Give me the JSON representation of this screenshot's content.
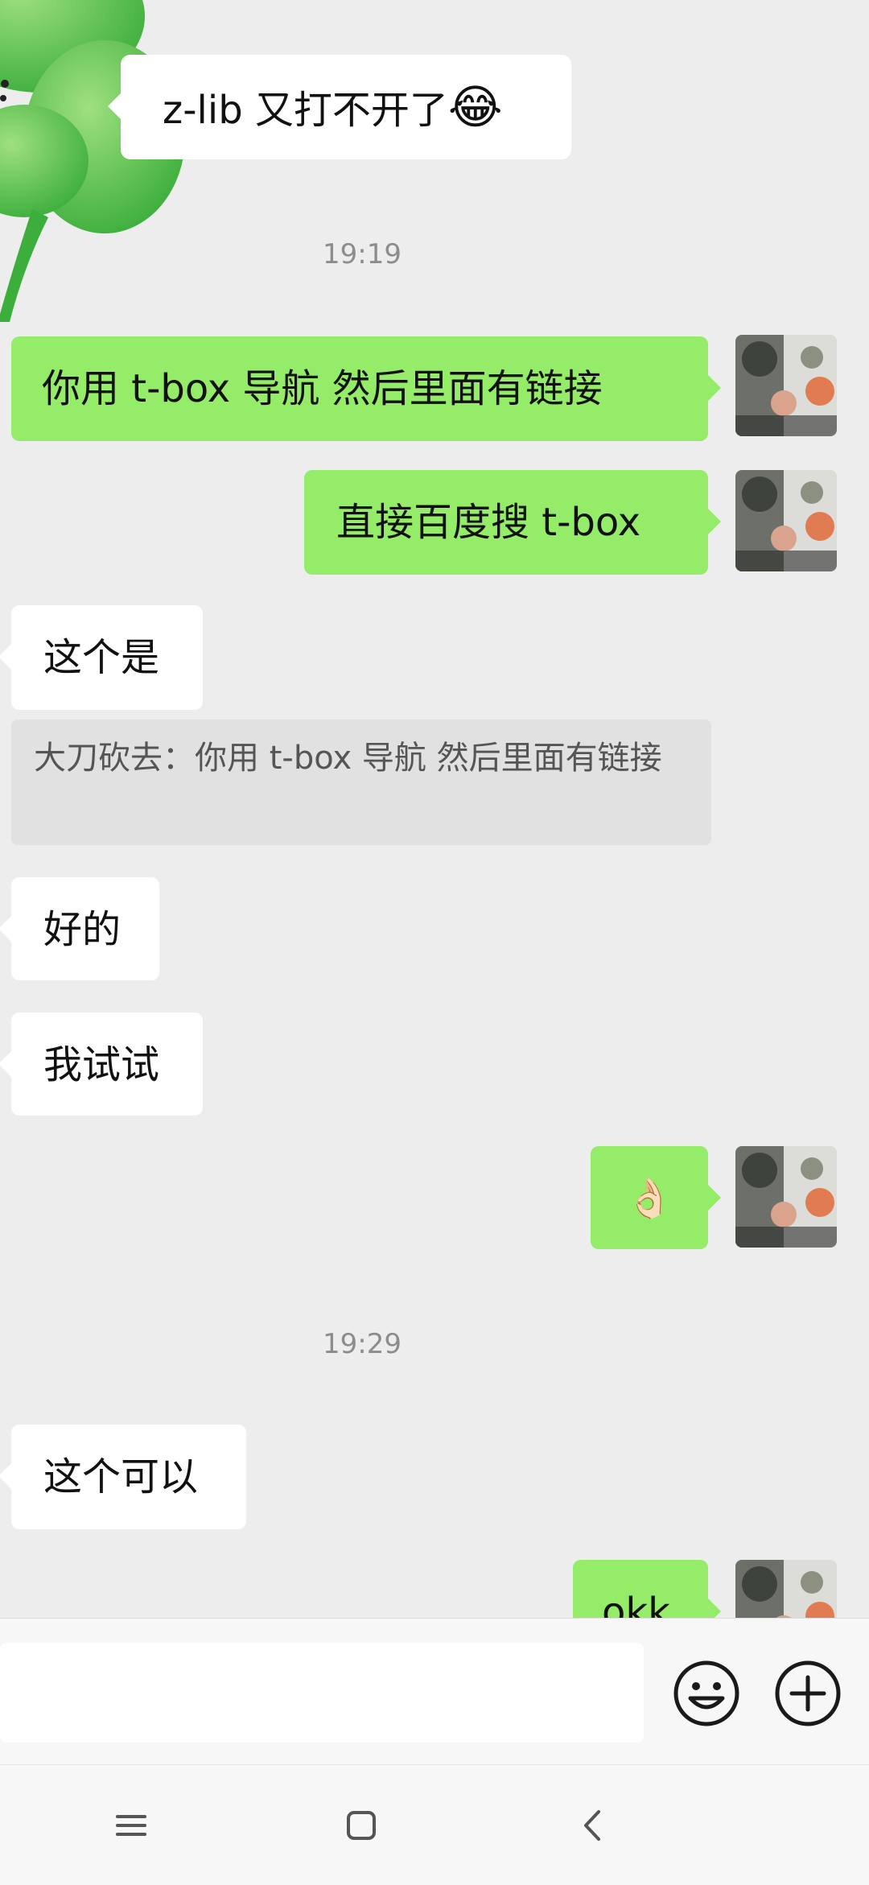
{
  "messages": {
    "m1": "z-lib 又打不开了",
    "m1_emoji": "😂",
    "t1": "19:19",
    "m2": "你用 t-box 导航 然后里面有链接",
    "m3": "直接百度搜 t-box",
    "m4": "这个是",
    "quote": "大刀砍去：你用 t-box 导航 然后里面有链接",
    "m5": "好的",
    "m6": "我试试",
    "m7": "👌🏻",
    "t2": "19:29",
    "m8": "这个可以",
    "m9": "okk"
  },
  "input": {
    "placeholder": ""
  },
  "icons": {
    "emoji_button": "smiley-icon",
    "more_button": "plus-circle-icon",
    "nav_menu": "menu-lines-icon",
    "nav_home": "square-home-icon",
    "nav_back": "chevron-left-icon"
  },
  "colors": {
    "outgoing_bubble": "#95ec69",
    "incoming_bubble": "#ffffff",
    "chat_background": "#ededed"
  }
}
